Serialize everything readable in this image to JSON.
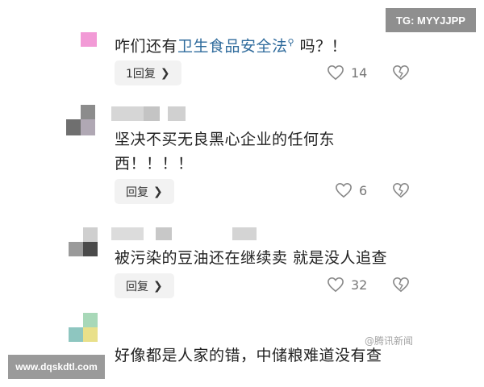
{
  "watermarks": {
    "tg": "TG: MYYJJPP",
    "site": "www.dqskdtl.com",
    "source": "@腾讯新闻"
  },
  "comments": [
    {
      "prefix": "咋们还有",
      "link": "卫生食品安全法",
      "suffix": " 吗？！",
      "reply_label": "1回复",
      "like_count": "14"
    },
    {
      "line1": "坚决不买无良黑心企业的任何东",
      "line2": "西！！！！",
      "reply_label": "回复",
      "like_count": "6"
    },
    {
      "text": "被污染的豆油还在继续卖 就是没人追查",
      "reply_label": "回复",
      "like_count": "32"
    },
    {
      "text": "好像都是人家的错，中储粮难道没有查"
    }
  ],
  "icons": {
    "like": "heart-outline-icon",
    "dislike": "broken-heart-icon",
    "reply_chevron": "chevron-right-icon",
    "link_search": "search-icon"
  }
}
